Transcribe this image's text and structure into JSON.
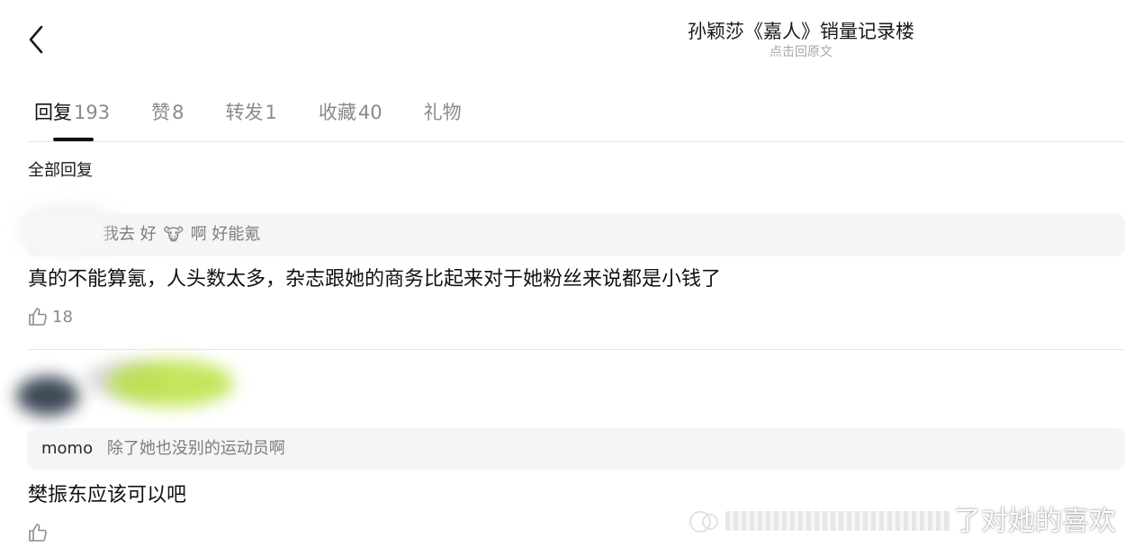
{
  "header": {
    "title": "孙颖莎《嘉人》销量记录楼",
    "subtitle": "点击回原文",
    "back_icon": "chevron-left-icon"
  },
  "tabs": [
    {
      "label": "回复",
      "count": "193",
      "active": true
    },
    {
      "label": "赞",
      "count": "8",
      "active": false
    },
    {
      "label": "转发",
      "count": "1",
      "active": false
    },
    {
      "label": "收藏",
      "count": "40",
      "active": false
    },
    {
      "label": "礼物",
      "count": "",
      "active": false
    }
  ],
  "section_heading": "全部回复",
  "comments": [
    {
      "quote": {
        "text_before": "我去 好",
        "emoji": "🐮",
        "text_after": "啊 好能氪"
      },
      "text": "真的不能算氪，人头数太多，杂志跟她的商务比起来对于她粉丝来说都是小钱了",
      "likes": "18"
    },
    {
      "quote": {
        "author": "momo",
        "text": "除了她也没别的运动员啊"
      },
      "text": "樊振东应该可以吧",
      "likes": ""
    }
  ],
  "watermark": {
    "text": "了对她的喜欢"
  },
  "colors": {
    "accent": "#111111",
    "muted": "#8a8a8a",
    "quote_bg": "#f5f5f5",
    "divider": "#e8e8e8",
    "blur_green": "#b9e23f"
  }
}
